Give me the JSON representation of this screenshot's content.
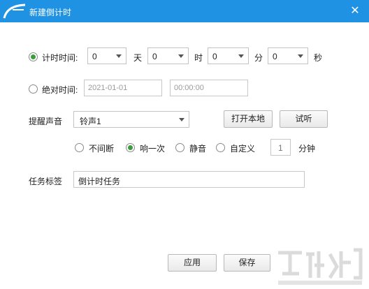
{
  "window": {
    "title": "新建倒计时",
    "close_icon": "close-icon"
  },
  "countdown": {
    "label": "计时时间:",
    "days_value": "0",
    "days_unit": "天",
    "hours_value": "0",
    "hours_unit": "时",
    "minutes_value": "0",
    "minutes_unit": "分",
    "seconds_value": "0",
    "seconds_unit": "秒",
    "checked": true
  },
  "absolute": {
    "label": "绝对时间:",
    "date_placeholder": "2021-01-01",
    "time_placeholder": "00:00:00",
    "checked": false
  },
  "sound": {
    "label": "提醒声音",
    "selected": "铃声1",
    "open_local": "打开本地",
    "preview": "试听",
    "options": [
      {
        "label": "不间断",
        "checked": false
      },
      {
        "label": "响一次",
        "checked": true
      },
      {
        "label": "静音",
        "checked": false
      },
      {
        "label": "自定义",
        "checked": false
      }
    ],
    "custom_minutes": "1",
    "minutes_unit": "分钟"
  },
  "task": {
    "label": "任务标签",
    "value": "倒计时任务"
  },
  "footer": {
    "apply": "应用",
    "save": "保存"
  },
  "accent_color": "#1f92e4",
  "radio_color": "#3b9c3b"
}
